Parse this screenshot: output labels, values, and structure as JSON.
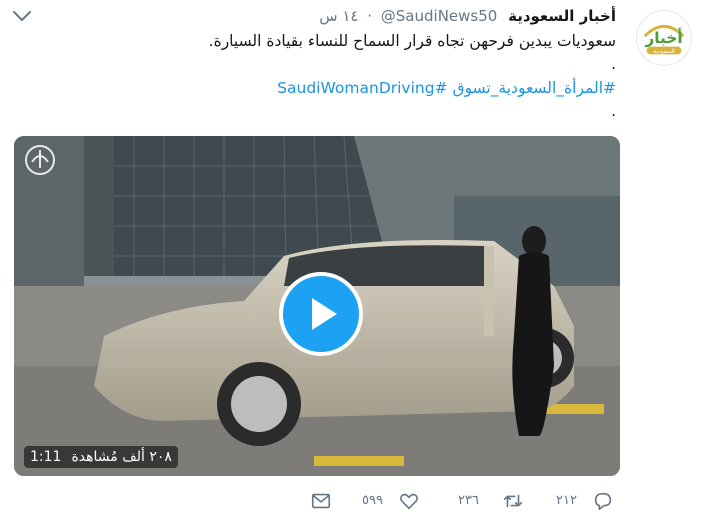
{
  "tweet": {
    "name": "أخبار السعودية",
    "handle": "@SaudiNews50",
    "separator": "·",
    "time": "١٤ س",
    "lines": [
      "سعوديات يبدين فرحهن تجاه قرار السماح للنساء بقيادة السيارة.",
      ".",
      "#المرأة_السعودية_تسوق #SaudiWomanDriving",
      "."
    ],
    "avatar": {
      "text": "أخبار",
      "subtext": "السعودية"
    }
  },
  "video": {
    "duration": "1:11",
    "views": "٢٠٨ ألف مُشاهدة",
    "play_icon": "play-icon",
    "watermark_icon": "police-emblem-icon"
  },
  "actions": {
    "reply_count": "٢١٢",
    "retweet_count": "٢٣٦",
    "like_count": "٥٩٩",
    "reply_icon": "reply-icon",
    "retweet_icon": "retweet-icon",
    "like_icon": "heart-icon",
    "dm_icon": "mail-icon"
  },
  "colors": {
    "link": "#1b95e0",
    "secondary": "#657786",
    "play_bg": "#1da1f2",
    "avatar_green": "#4a9c3b",
    "avatar_gold": "#d8b23a"
  }
}
